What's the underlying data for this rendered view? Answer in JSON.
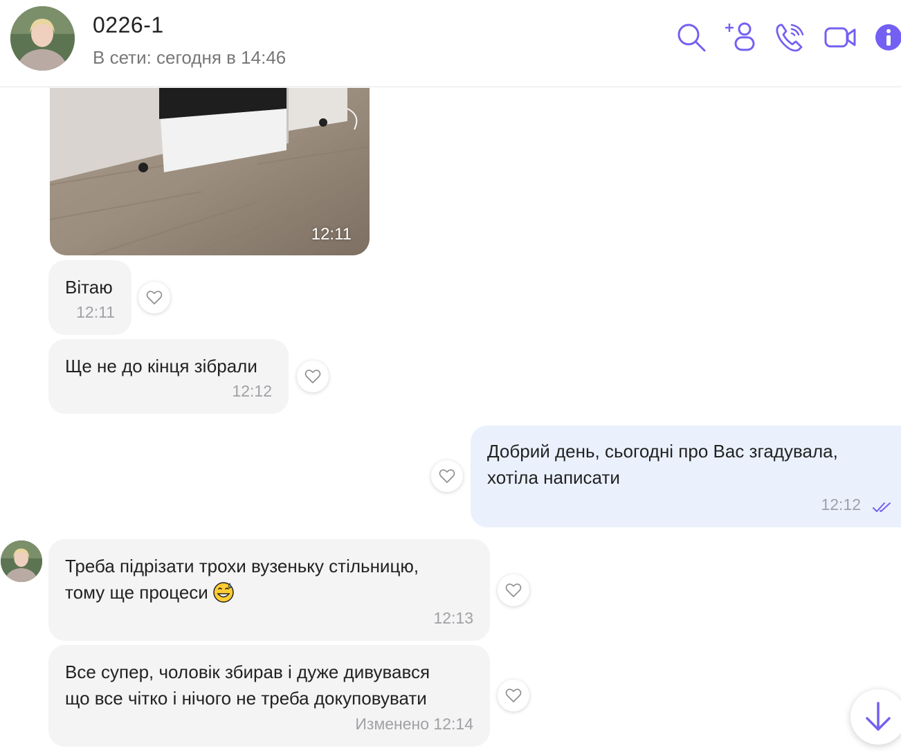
{
  "header": {
    "title": "0226-1",
    "status": "В сети: сегодня в 14:46",
    "icons": [
      "search-icon",
      "add-participant-icon",
      "voice-call-icon",
      "video-call-icon",
      "info-icon"
    ],
    "accent": "#7360f2"
  },
  "messages": [
    {
      "type": "photo",
      "direction": "in",
      "time": "12:11"
    },
    {
      "type": "text",
      "direction": "in",
      "text": "Вітаю",
      "time": "12:11"
    },
    {
      "type": "text",
      "direction": "in",
      "text": "Ще не до кінця зібрали",
      "time": "12:12"
    },
    {
      "type": "text",
      "direction": "out",
      "line1": "Добрий день, сьогодні про Вас згадувала,",
      "line2": "хотіла написати",
      "time": "12:12",
      "status": "read"
    },
    {
      "type": "text",
      "direction": "in",
      "line1": "Треба підрізати трохи вузеньку стільницю,",
      "line2": "тому ще процеси",
      "emoji": "grinning-sweat-emoji",
      "time": "12:13"
    },
    {
      "type": "text",
      "direction": "in",
      "line1": "Все супер, чоловік збирав і дуже дивувався",
      "line2": "що все чітко і нічого не треба докуповувати",
      "time": "Изменено 12:14"
    }
  ],
  "colors": {
    "incoming_bubble": "#f4f4f4",
    "outgoing_bubble": "#eaf1fd",
    "timestamp": "#a0a0a6"
  }
}
